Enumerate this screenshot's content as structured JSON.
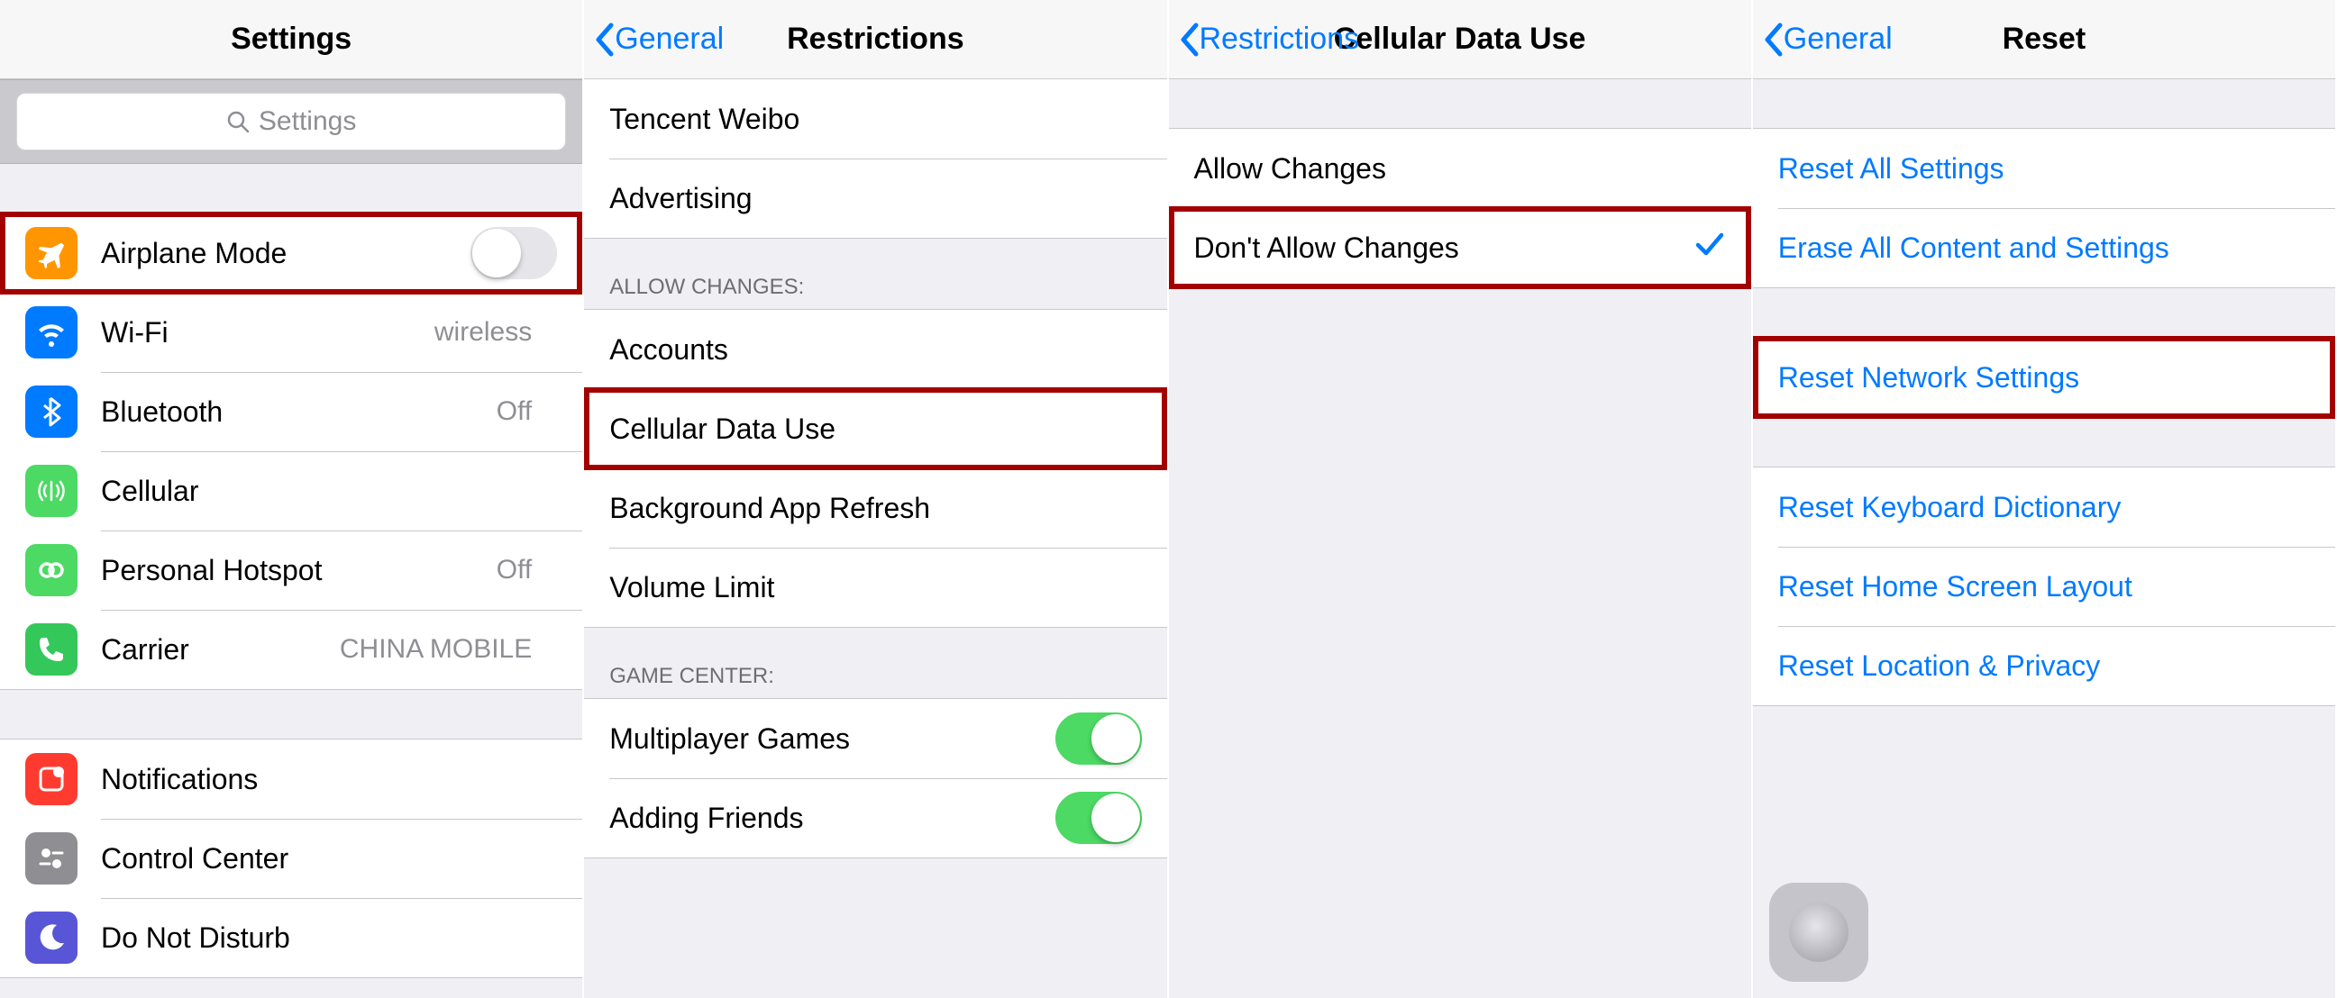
{
  "panel1": {
    "title": "Settings",
    "search_placeholder": "Settings",
    "group1": [
      {
        "name": "airplane",
        "label": "Airplane Mode",
        "toggle": "off",
        "icon": "airplane-icon",
        "color": "bg-orange"
      },
      {
        "name": "wifi",
        "label": "Wi-Fi",
        "detail": "wireless",
        "icon": "wifi-icon",
        "color": "bg-blue"
      },
      {
        "name": "bluetooth",
        "label": "Bluetooth",
        "detail": "Off",
        "icon": "bluetooth-icon",
        "color": "bg-blue"
      },
      {
        "name": "cellular",
        "label": "Cellular",
        "detail": "",
        "icon": "cellular-icon",
        "color": "bg-green"
      },
      {
        "name": "hotspot",
        "label": "Personal Hotspot",
        "detail": "Off",
        "icon": "hotspot-icon",
        "color": "bg-green"
      },
      {
        "name": "carrier",
        "label": "Carrier",
        "detail": "CHINA MOBILE",
        "icon": "phone-icon",
        "color": "bg-green2"
      }
    ],
    "group2": [
      {
        "name": "notifications",
        "label": "Notifications",
        "icon": "notifications-icon",
        "color": "bg-red"
      },
      {
        "name": "control-center",
        "label": "Control Center",
        "icon": "control-center-icon",
        "color": "bg-gray"
      },
      {
        "name": "dnd",
        "label": "Do Not Disturb",
        "icon": "moon-icon",
        "color": "bg-indigo"
      }
    ]
  },
  "panel2": {
    "back": "General",
    "title": "Restrictions",
    "top_rows": [
      {
        "name": "tencent-weibo",
        "label": "Tencent Weibo"
      },
      {
        "name": "advertising",
        "label": "Advertising"
      }
    ],
    "allow_header": "ALLOW CHANGES:",
    "allow_rows": [
      {
        "name": "accounts",
        "label": "Accounts"
      },
      {
        "name": "cellular-data-use",
        "label": "Cellular Data Use"
      },
      {
        "name": "background-app-refresh",
        "label": "Background App Refresh"
      },
      {
        "name": "volume-limit",
        "label": "Volume Limit"
      }
    ],
    "gc_header": "GAME CENTER:",
    "gc_rows": [
      {
        "name": "multiplayer-games",
        "label": "Multiplayer Games",
        "on": true
      },
      {
        "name": "adding-friends",
        "label": "Adding Friends",
        "on": true
      }
    ]
  },
  "panel3": {
    "back": "Restrictions",
    "title": "Cellular Data Use",
    "rows": [
      {
        "name": "allow-changes",
        "label": "Allow Changes",
        "checked": false
      },
      {
        "name": "dont-allow-changes",
        "label": "Don't Allow Changes",
        "checked": true
      }
    ]
  },
  "panel4": {
    "back": "General",
    "title": "Reset",
    "group1": [
      {
        "name": "reset-all",
        "label": "Reset All Settings"
      },
      {
        "name": "erase-all",
        "label": "Erase All Content and Settings"
      }
    ],
    "group2": [
      {
        "name": "reset-network",
        "label": "Reset Network Settings"
      }
    ],
    "group3": [
      {
        "name": "reset-keyboard",
        "label": "Reset Keyboard Dictionary"
      },
      {
        "name": "reset-home",
        "label": "Reset Home Screen Layout"
      },
      {
        "name": "reset-location",
        "label": "Reset Location & Privacy"
      }
    ]
  }
}
